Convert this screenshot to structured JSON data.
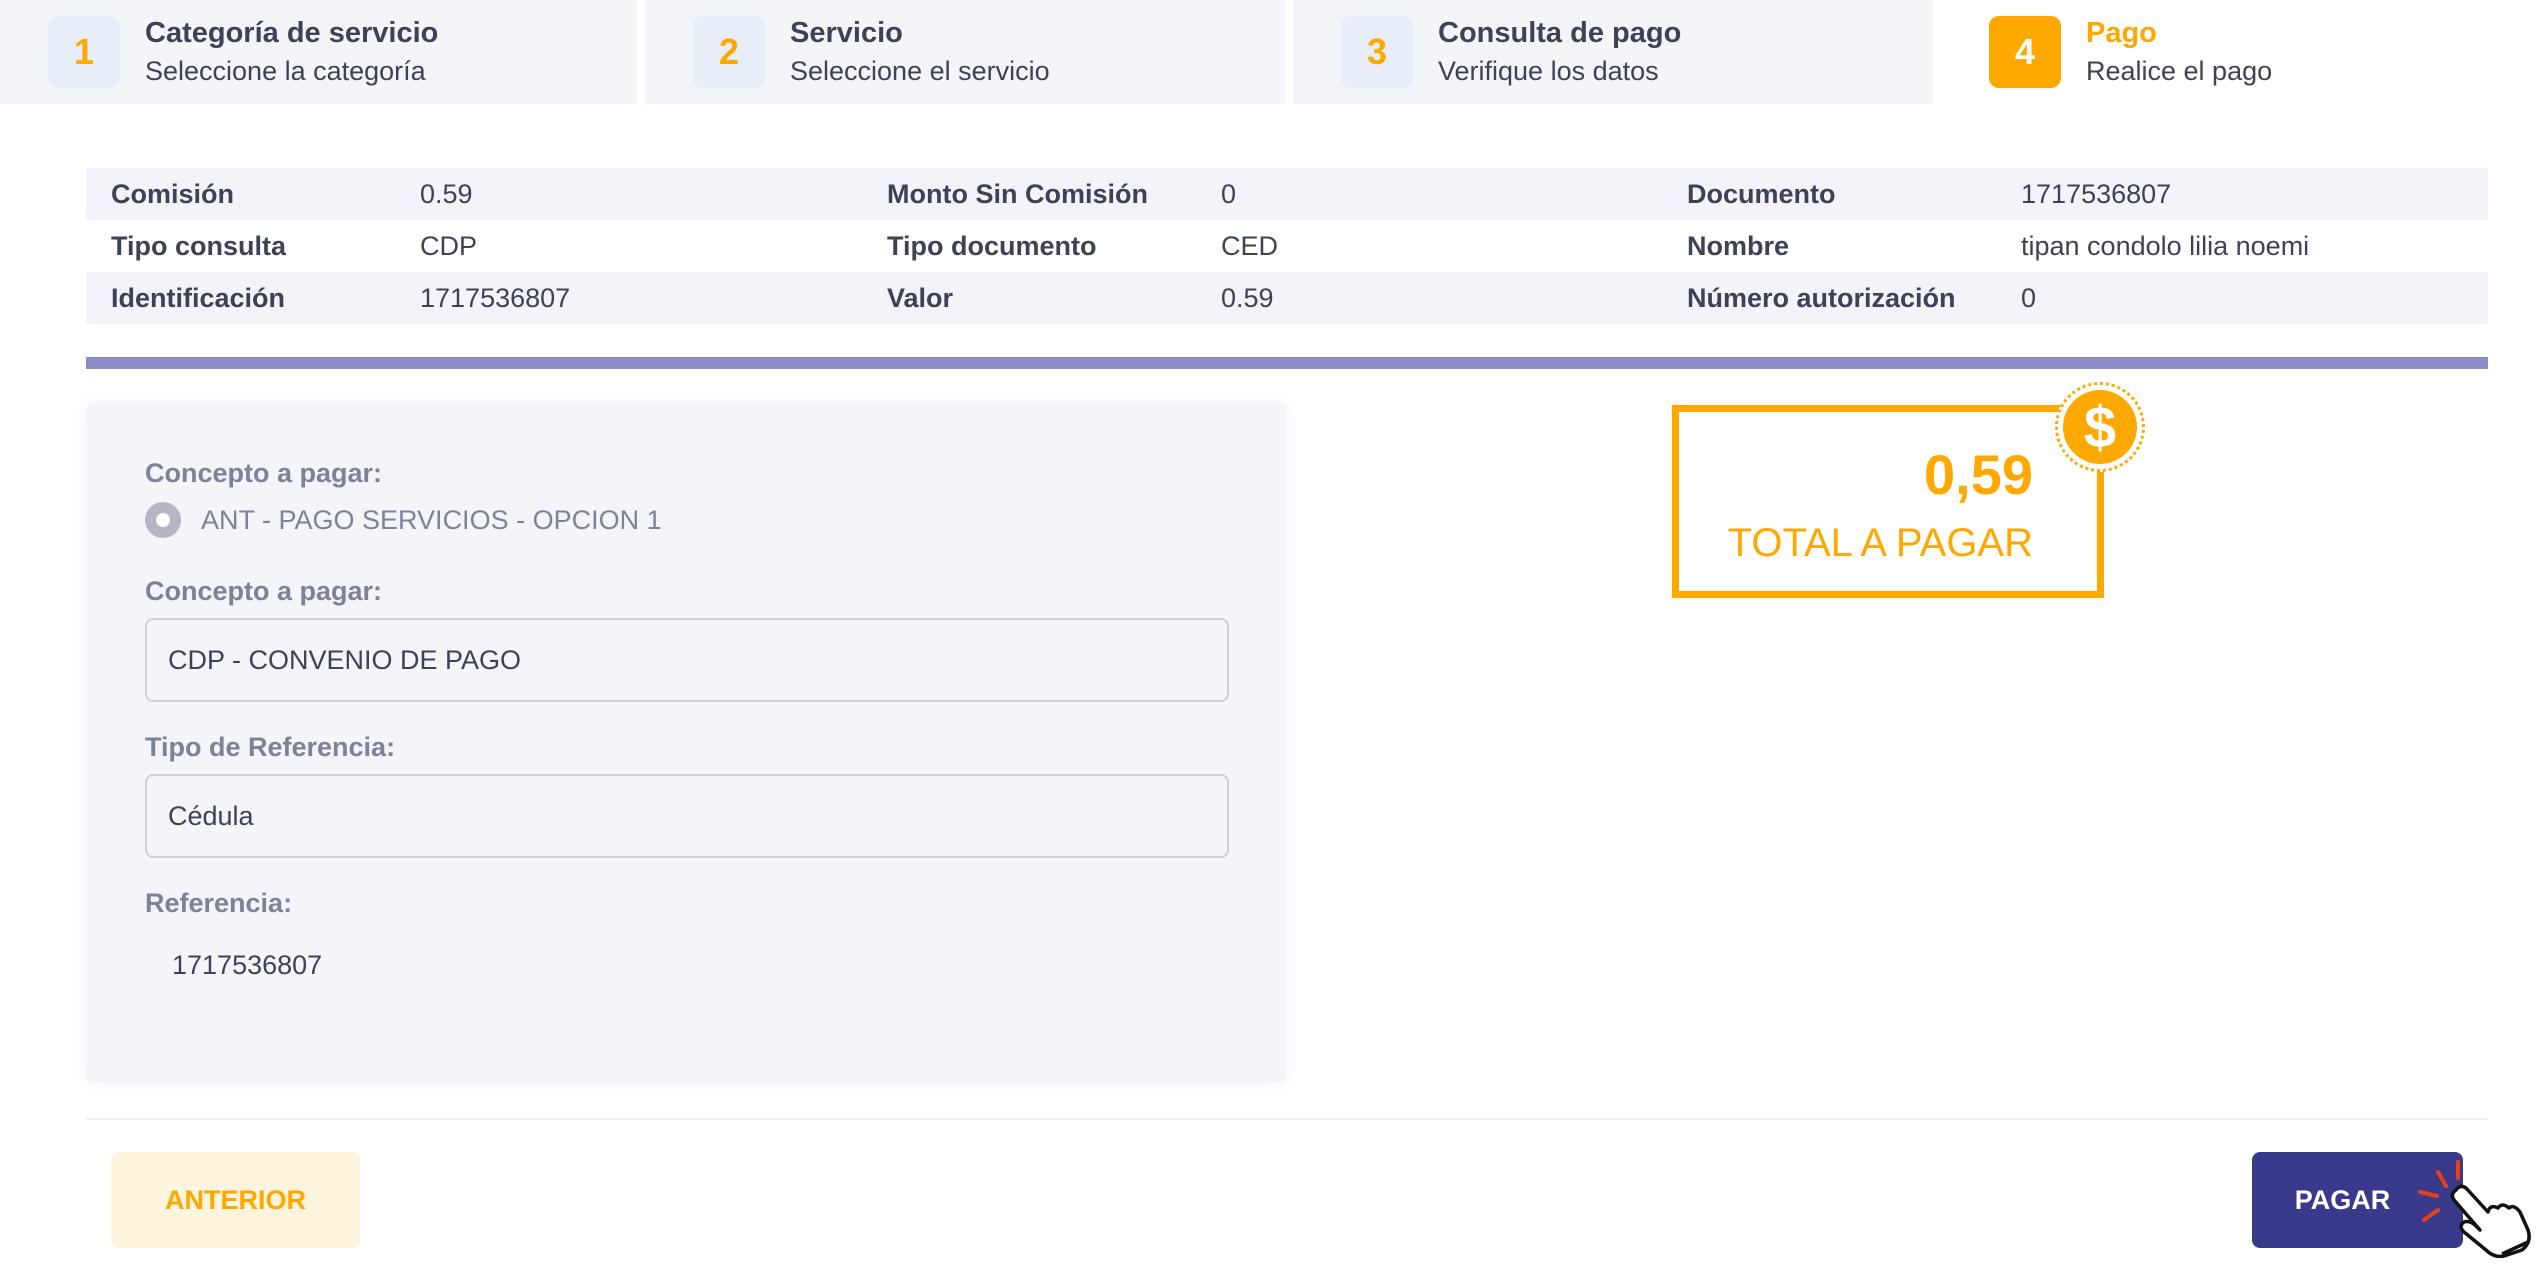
{
  "stepper": [
    {
      "number": "1",
      "title": "Categoría de servicio",
      "subtitle": "Seleccione la categoría"
    },
    {
      "number": "2",
      "title": "Servicio",
      "subtitle": "Seleccione el servicio"
    },
    {
      "number": "3",
      "title": "Consulta de pago",
      "subtitle": "Verifique los datos"
    },
    {
      "number": "4",
      "title": "Pago",
      "subtitle": "Realice el pago"
    }
  ],
  "info": [
    [
      {
        "label": "Comisión",
        "value": "0.59"
      },
      {
        "label": "Monto Sin Comisión",
        "value": "0"
      },
      {
        "label": "Documento",
        "value": "1717536807"
      }
    ],
    [
      {
        "label": "Tipo consulta",
        "value": "CDP"
      },
      {
        "label": "Tipo documento",
        "value": "CED"
      },
      {
        "label": "Nombre",
        "value": "tipan condolo lilia noemi"
      }
    ],
    [
      {
        "label": "Identificación",
        "value": "1717536807"
      },
      {
        "label": "Valor",
        "value": "0.59"
      },
      {
        "label": "Número autorización",
        "value": "0"
      }
    ]
  ],
  "form": {
    "concept_label_1": "Concepto a pagar:",
    "concept_option": "ANT - PAGO SERVICIOS - OPCION 1",
    "concept_label_2": "Concepto a pagar:",
    "concept_value": "CDP - CONVENIO DE PAGO",
    "ref_type_label": "Tipo de Referencia:",
    "ref_type_value": "Cédula",
    "ref_label": "Referencia:",
    "ref_value": "1717536807"
  },
  "total": {
    "amount": "0,59",
    "label": "TOTAL A PAGAR",
    "coin_symbol": "$"
  },
  "buttons": {
    "previous": "ANTERIOR",
    "pay": "PAGAR"
  },
  "colors": {
    "accent": "#ffa800",
    "primary": "#3a3a8c",
    "bar": "#8c8cc6"
  }
}
